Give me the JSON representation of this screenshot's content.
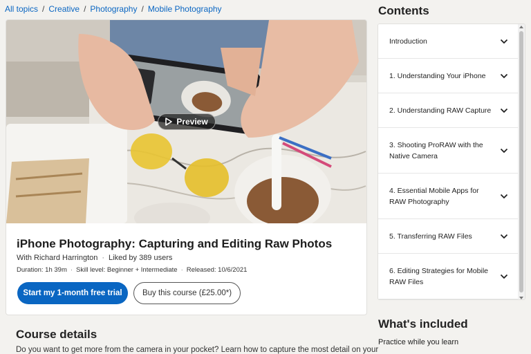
{
  "breadcrumb": {
    "items": [
      "All topics",
      "Creative",
      "Photography",
      "Mobile Photography"
    ],
    "separator": "/"
  },
  "hero": {
    "preview_label": "Preview",
    "preview_icon": "play-icon"
  },
  "course": {
    "title": "iPhone Photography: Capturing and Editing Raw Photos",
    "author": "With Richard Harrington",
    "likes": "Liked by 389 users",
    "duration": "Duration: 1h 39m",
    "skill": "Skill level: Beginner + Intermediate",
    "released": "Released: 10/6/2021",
    "primary_button": "Start my 1-month free trial",
    "secondary_button": "Buy this course (£25.00*)"
  },
  "details": {
    "heading": "Course details",
    "text": "Do you want to get more from the camera in your pocket? Learn how to capture the most detail on your"
  },
  "contents": {
    "heading": "Contents",
    "items": [
      "Introduction",
      "1. Understanding Your iPhone",
      "2. Understanding RAW Capture",
      "3. Shooting ProRAW with the Native Camera",
      "4. Essential Mobile Apps for RAW Photography",
      "5. Transferring RAW Files",
      "6. Editing Strategies for Mobile RAW Files"
    ],
    "chevron_icon": "chevron-down-icon"
  },
  "included": {
    "heading": "What's included",
    "items": [
      "Practice while you learn"
    ]
  },
  "colors": {
    "accent": "#0a66c2",
    "page_bg": "#f3f2ef"
  }
}
